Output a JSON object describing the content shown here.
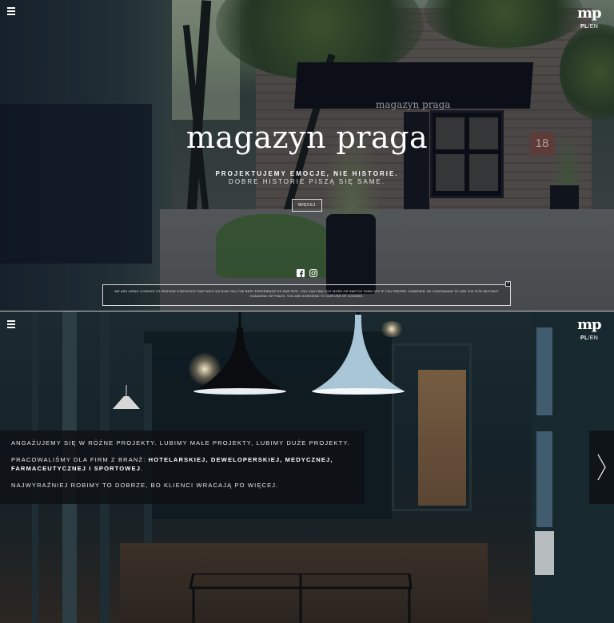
{
  "hero": {
    "title": "magazyn praga",
    "tagline_line1": "PROJEKTUJEMY EMOCJE, NIE HISTORIE.",
    "tagline_line2": "DOBRE HISTORIE PISZĄ SIĘ SAME.",
    "more_button": "WIĘCEJ",
    "sign_text": "magazyn praga",
    "house_number": "18"
  },
  "brand": {
    "logo": "mp",
    "lang_pl": "PL",
    "lang_sep": "/",
    "lang_en": "EN"
  },
  "social": {
    "icons": [
      "facebook-icon",
      "instagram-icon"
    ]
  },
  "cookie": {
    "text": "WE ARE USING COOKIES TO PROVIDE STATISTICS THAT HELP US GIVE YOU THE BEST EXPERIENCE OF OUR SITE. YOU CAN FIND OUT MORE OR SWITCH THEM OFF IF YOU PREFER. HOWEVER, BY CONTINUING TO USE THE SITE WITHOUT CHANGING SETTINGS, YOU ARE AGREEING TO OUR USE OF COOKIES.",
    "close": "×"
  },
  "about": {
    "line1": "ANGAŻUJEMY SIĘ W RÓŻNE PROJEKTY. LUBIMY MAŁE PROJEKTY, LUBIMY DUŻE PROJEKTY.",
    "line2_prefix": "PRACOWALIŚMY DLA FIRM Z BRANŻ: ",
    "line2_bold": "HOTELARSKIEJ, DEWELOPERSKIEJ, MEDYCZNEJ, FARMACEUTYCZNEJ I SPORTOWEJ",
    "line2_suffix": ".",
    "line3": "NAJWYRAŹNIEJ ROBIMY TO DOBRZE, BO KLIENCI WRACAJĄ PO WIĘCEJ."
  },
  "colors": {
    "text": "#ffffff",
    "panel": "#0e1216"
  }
}
